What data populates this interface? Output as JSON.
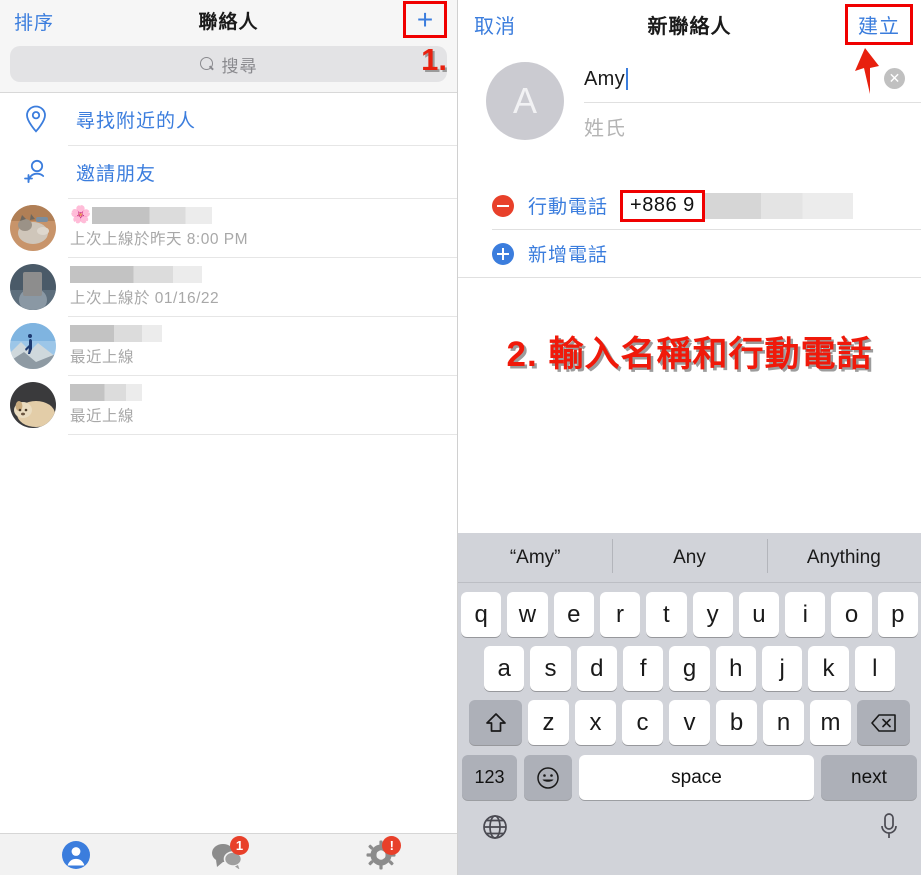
{
  "left_panel": {
    "header": {
      "sort_label": "排序",
      "title": "聯絡人",
      "add_icon": "plus-icon"
    },
    "annotation_1": "1.",
    "search": {
      "placeholder": "搜尋",
      "icon": "search-icon"
    },
    "actions": [
      {
        "label": "尋找附近的人",
        "icon": "location-pin-icon"
      },
      {
        "label": "邀請朋友",
        "icon": "add-person-icon"
      }
    ],
    "contacts": [
      {
        "name_redacted": true,
        "emoji": "🌸",
        "status": "上次上線於昨天 8:00 PM",
        "avatar": "cat-photo"
      },
      {
        "name_redacted": true,
        "emoji": "",
        "status": "上次上線於 01/16/22",
        "avatar": "person-photo"
      },
      {
        "name_redacted": true,
        "emoji": "",
        "status": "最近上線",
        "avatar": "hiker-photo"
      },
      {
        "name_redacted": true,
        "emoji": "",
        "status": "最近上線",
        "avatar": "dog-photo"
      }
    ],
    "tabbar": [
      {
        "name": "contacts",
        "icon": "person-filled-icon",
        "badge": "",
        "active": true
      },
      {
        "name": "chats",
        "icon": "chat-bubbles-icon",
        "badge": "1",
        "active": false
      },
      {
        "name": "settings",
        "icon": "gear-icon",
        "badge": "!",
        "active": false
      }
    ]
  },
  "right_panel": {
    "header": {
      "cancel_label": "取消",
      "title": "新聯絡人",
      "create_label": "建立"
    },
    "avatar_initial": "A",
    "first_name_value": "Amy",
    "last_name_placeholder": "姓氏",
    "clear_icon": "clear-circle-icon",
    "phone": {
      "remove_icon": "minus-circle-icon",
      "label": "行動電話",
      "number_prefix": "+886 9",
      "number_redacted": true
    },
    "add_phone": {
      "add_icon": "plus-circle-icon",
      "label": "新增電話"
    },
    "annotation_2": "2. 輸入名稱和行動電話"
  },
  "keyboard": {
    "suggestions": [
      "“Amy”",
      "Any",
      "Anything"
    ],
    "row1": [
      "q",
      "w",
      "e",
      "r",
      "t",
      "y",
      "u",
      "i",
      "o",
      "p"
    ],
    "row2": [
      "a",
      "s",
      "d",
      "f",
      "g",
      "h",
      "j",
      "k",
      "l"
    ],
    "row3": [
      "z",
      "x",
      "c",
      "v",
      "b",
      "n",
      "m"
    ],
    "shift_icon": "shift-up-arrow-icon",
    "backspace_icon": "backspace-icon",
    "num_key": "123",
    "emoji_key": "emoji-smiley-icon",
    "space_key": "space",
    "next_key": "next",
    "globe_icon": "globe-icon",
    "mic_icon": "microphone-icon"
  },
  "colors": {
    "accent_blue": "#3b7ddd",
    "annotation_red": "#f0190a",
    "badge_red": "#e8402a",
    "keyboard_bg": "#d1d3d9"
  }
}
